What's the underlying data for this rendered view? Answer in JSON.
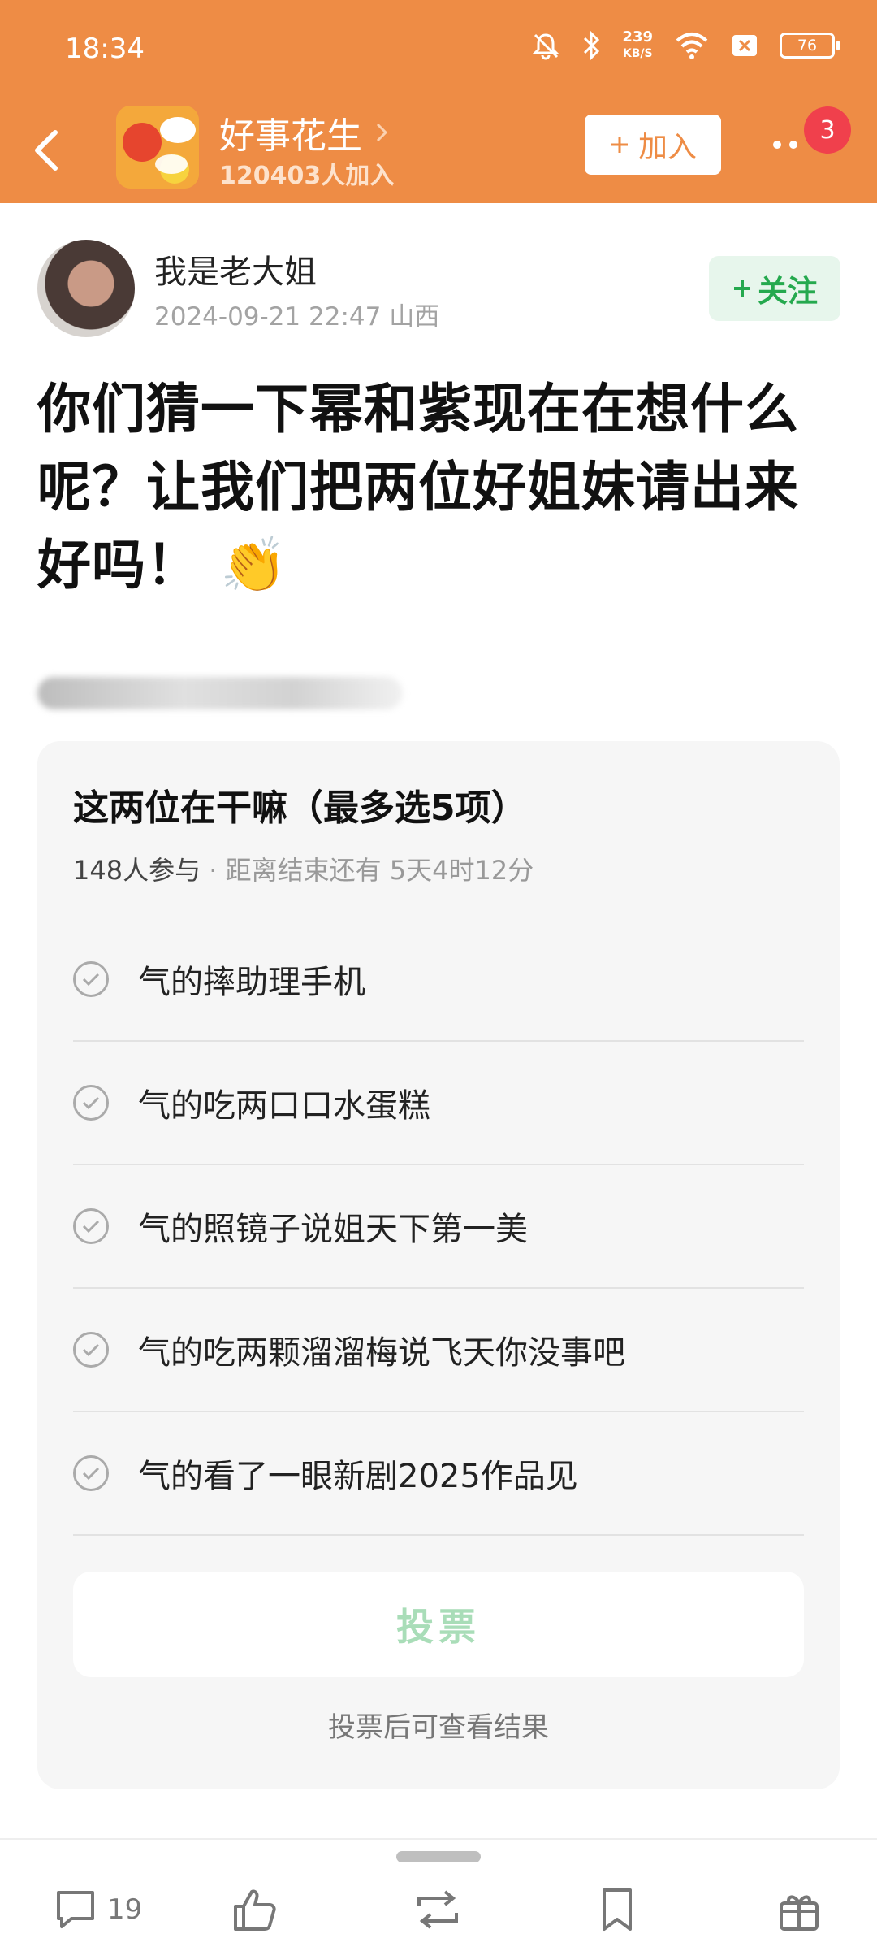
{
  "status_bar": {
    "time": "18:34",
    "net_speed_value": "239",
    "net_speed_unit": "KB/S",
    "battery": "76"
  },
  "group": {
    "name": "好事花生",
    "members": "120403人加入",
    "join_label": "加入",
    "notification_count": "3"
  },
  "post": {
    "author": "我是老大姐",
    "date": "2024-09-21 22:47",
    "location": "山西",
    "follow_label": "关注",
    "title": "你们猜一下幂和紫现在在想什么呢？让我们把两位好姐妹请出来好吗！",
    "title_emoji": "👏"
  },
  "poll": {
    "title": "这两位在干嘛（最多选5项）",
    "participants": "148人参与",
    "separator": " · ",
    "deadline": "距离结束还有 5天4时12分",
    "options": [
      {
        "label": "气的摔助理手机"
      },
      {
        "label": "气的吃两口口水蛋糕"
      },
      {
        "label": "气的照镜子说姐天下第一美"
      },
      {
        "label": "气的吃两颗溜溜梅说飞天你没事吧"
      },
      {
        "label": "气的看了一眼新剧2025作品见"
      }
    ],
    "vote_label": "投票",
    "hint": "投票后可查看结果"
  },
  "bottom_bar": {
    "comment_count": "19"
  },
  "colors": {
    "header": "#ee8c45",
    "follow_green": "#25a94e",
    "vote_green": "#a9ddb8",
    "badge_red": "#f0404c"
  },
  "icons": [
    "back-icon",
    "chevron-right-icon",
    "mute-icon",
    "bluetooth-icon",
    "wifi-icon",
    "sim-icon",
    "battery-icon",
    "check-circle-icon",
    "comment-icon",
    "like-icon",
    "repost-icon",
    "bookmark-icon",
    "gift-icon"
  ]
}
